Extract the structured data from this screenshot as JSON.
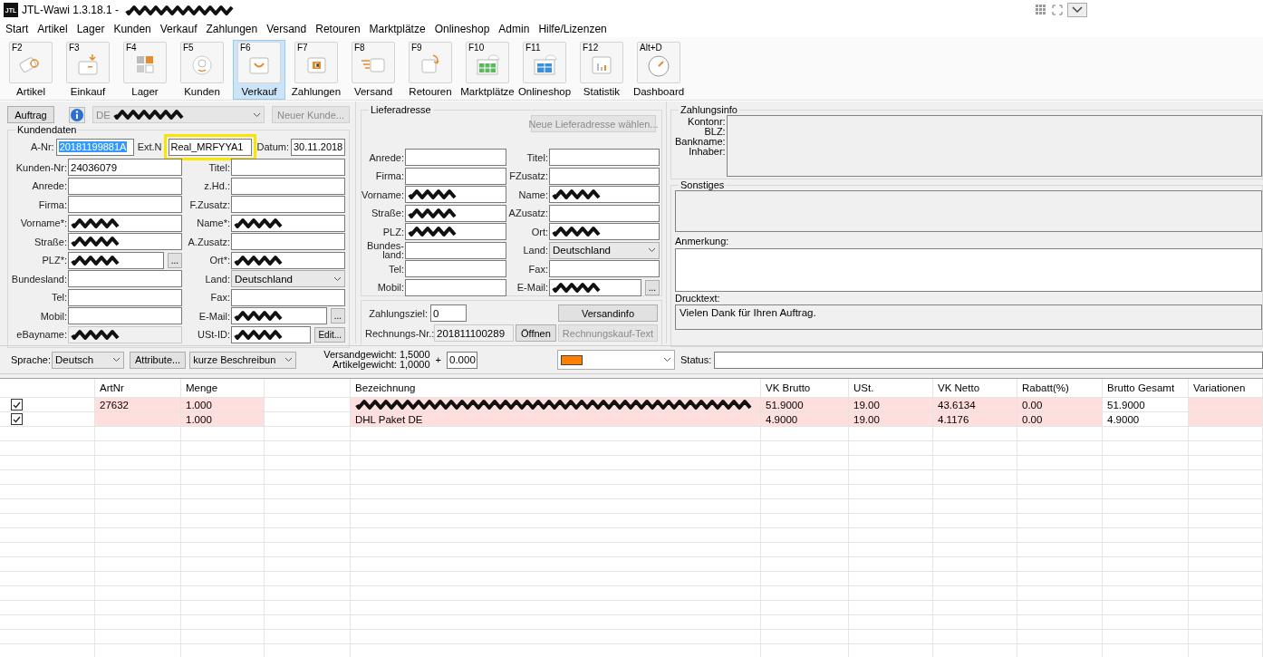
{
  "title_bar": {
    "logo": "JTL",
    "title": "JTL-Wawi 1.3.18.1 - ",
    "title_redacted": true
  },
  "menu": [
    "Start",
    "Artikel",
    "Lager",
    "Kunden",
    "Verkauf",
    "Zahlungen",
    "Versand",
    "Retouren",
    "Marktplätze",
    "Onlineshop",
    "Admin",
    "Hilfe/Lizenzen"
  ],
  "toolbar": [
    {
      "key": "F2",
      "label": "Artikel",
      "selected": false
    },
    {
      "key": "F3",
      "label": "Einkauf",
      "selected": false
    },
    {
      "key": "F4",
      "label": "Lager",
      "selected": false
    },
    {
      "key": "F5",
      "label": "Kunden",
      "selected": false
    },
    {
      "key": "F6",
      "label": "Verkauf",
      "selected": true
    },
    {
      "key": "F7",
      "label": "Zahlungen",
      "selected": false
    },
    {
      "key": "F8",
      "label": "Versand",
      "selected": false
    },
    {
      "key": "F9",
      "label": "Retouren",
      "selected": false
    },
    {
      "key": "F10",
      "label": "Marktplätze",
      "selected": false
    },
    {
      "key": "F11",
      "label": "Onlineshop",
      "selected": false
    },
    {
      "key": "F12",
      "label": "Statistik",
      "selected": false
    },
    {
      "key": "Alt+D",
      "label": "Dashboard",
      "selected": false
    }
  ],
  "customer": {
    "order_button": "Auftrag",
    "customer_select": {
      "value": "DE",
      "redacted": true,
      "disabled": true
    },
    "new_customer_button": {
      "label": "Neuer Kunde...",
      "disabled": true
    },
    "group_title": "Kundendaten",
    "order_row": {
      "a_nr": {
        "label": "A-Nr:",
        "value": "20181199881A",
        "text_selected": true
      },
      "ext_nr": {
        "label": "Ext.N",
        "value": "Real_MRFYYA1",
        "highlighted": true
      },
      "date": {
        "label": "Datum:",
        "value": "30.11.2018"
      }
    },
    "rows": [
      [
        {
          "kind": "input",
          "label": "Kunden-Nr:",
          "value": "24036079"
        },
        {
          "kind": "input",
          "label": "Titel:"
        }
      ],
      [
        {
          "kind": "input",
          "label": "Anrede:"
        },
        {
          "kind": "input",
          "label": "z.Hd.:"
        }
      ],
      [
        {
          "kind": "input",
          "label": "Firma:"
        },
        {
          "kind": "input",
          "label": "F.Zusatz:"
        }
      ],
      [
        {
          "kind": "input",
          "label": "Vorname*:",
          "redacted": true
        },
        {
          "kind": "input",
          "label": "Name*:",
          "redacted": true
        }
      ],
      [
        {
          "kind": "input",
          "label": "Straße:",
          "redacted": true
        },
        {
          "kind": "input",
          "label": "A.Zusatz:"
        }
      ],
      [
        {
          "kind": "input",
          "label": "PLZ*:",
          "redacted": true,
          "button": "..."
        },
        {
          "kind": "input",
          "label": "Ort*:",
          "redacted": true
        }
      ],
      [
        {
          "kind": "input",
          "label": "Bundesland:"
        },
        {
          "kind": "select",
          "label": "Land:",
          "value": "Deutschland"
        }
      ],
      [
        {
          "kind": "input",
          "label": "Tel:"
        },
        {
          "kind": "input",
          "label": "Fax:"
        }
      ],
      [
        {
          "kind": "input",
          "label": "Mobil:"
        },
        {
          "kind": "input",
          "label": "E-Mail:",
          "redacted": true,
          "button": "..."
        }
      ],
      [
        {
          "kind": "readonly",
          "label": "eBayname:",
          "redacted": true
        },
        {
          "kind": "input",
          "label": "USt-ID:",
          "redacted": true,
          "button": "Edit..."
        }
      ]
    ]
  },
  "delivery": {
    "group_title": "Lieferadresse",
    "choose_button": {
      "label": "Neue Lieferadresse wählen...",
      "disabled": true
    },
    "rows": [
      [
        {
          "kind": "input",
          "label": "Anrede:"
        },
        {
          "kind": "input",
          "label": "Titel:"
        }
      ],
      [
        {
          "kind": "input",
          "label": "Firma:"
        },
        {
          "kind": "input",
          "label": "FZusatz:"
        }
      ],
      [
        {
          "kind": "input",
          "label": "Vorname:",
          "redacted": true
        },
        {
          "kind": "input",
          "label": "Name:",
          "redacted": true
        }
      ],
      [
        {
          "kind": "input",
          "label": "Straße:",
          "redacted": true
        },
        {
          "kind": "input",
          "label": "AZusatz:"
        }
      ],
      [
        {
          "kind": "input",
          "label": "PLZ:",
          "redacted": true
        },
        {
          "kind": "input",
          "label": "Ort:",
          "redacted": true
        }
      ],
      [
        {
          "kind": "input",
          "label": "Bundes-\nland:"
        },
        {
          "kind": "select",
          "label": "Land:",
          "value": "Deutschland"
        }
      ],
      [
        {
          "kind": "input",
          "label": "Tel:"
        },
        {
          "kind": "input",
          "label": "Fax:"
        }
      ],
      [
        {
          "kind": "input",
          "label": "Mobil:"
        },
        {
          "kind": "input",
          "label": "E-Mail:",
          "redacted": true,
          "button": "..."
        }
      ]
    ]
  },
  "billing": {
    "payment_term": {
      "label": "Zahlungsziel:",
      "value": "0"
    },
    "shipping_info_button": {
      "label": "Versandinfo",
      "disabled": false
    },
    "invoice": {
      "label": "Rechnungs-Nr.:",
      "value": "201811100289"
    },
    "open_button": "Öffnen",
    "invoice_text_button": {
      "label": "Rechnungskauf-Text",
      "disabled": true
    }
  },
  "right": {
    "payment_info": {
      "group_title": "Zahlungsinfo",
      "labels": [
        "Kontonr:",
        "BLZ:",
        "Bankname:",
        "Inhaber:"
      ]
    },
    "misc": {
      "group_title": "Sonstiges"
    },
    "note": {
      "label": "Anmerkung:"
    },
    "print_text": {
      "label": "Drucktext:",
      "value": "Vielen Dank für Ihren Auftrag."
    }
  },
  "options": {
    "language": {
      "label": "Sprache:",
      "value": "Deutsch"
    },
    "attributes_button": "Attribute...",
    "description_select": "kurze Beschreibun",
    "shipping_weight": "Versandgewicht: 1,5000",
    "item_weight": "Artikelgewicht: 1,0000",
    "plus": "+",
    "extra_weight": "0.000",
    "color_select": {
      "color": "#ff8000"
    },
    "status": {
      "label": "Status:"
    }
  },
  "table": {
    "columns": [
      {
        "shaded": false
      },
      {
        "label": "ArtNr",
        "shaded": true
      },
      {
        "label": "Menge",
        "shaded": true
      },
      {
        "shaded": false
      },
      {
        "label": "Bezeichnung",
        "shaded": true
      },
      {
        "label": "VK Brutto",
        "shaded": true
      },
      {
        "label": "USt.",
        "shaded": true
      },
      {
        "label": "VK Netto",
        "shaded": true
      },
      {
        "label": "Rabatt(%)",
        "shaded": true
      },
      {
        "label": "Brutto Gesamt",
        "shaded": false
      },
      {
        "label": "Variationen",
        "shaded": true
      }
    ],
    "rows": [
      {
        "checked": true,
        "cells": [
          null,
          "27632",
          "1.000",
          null,
          {
            "redacted": true
          },
          "51.9000",
          "19.00",
          "43.6134",
          "0.00",
          "51.9000",
          null
        ]
      },
      {
        "checked": true,
        "cells": [
          null,
          null,
          "1.000",
          null,
          "DHL Paket DE",
          "4.9000",
          "19.00",
          "4.1176",
          "0.00",
          "4.9000",
          null
        ]
      }
    ]
  }
}
